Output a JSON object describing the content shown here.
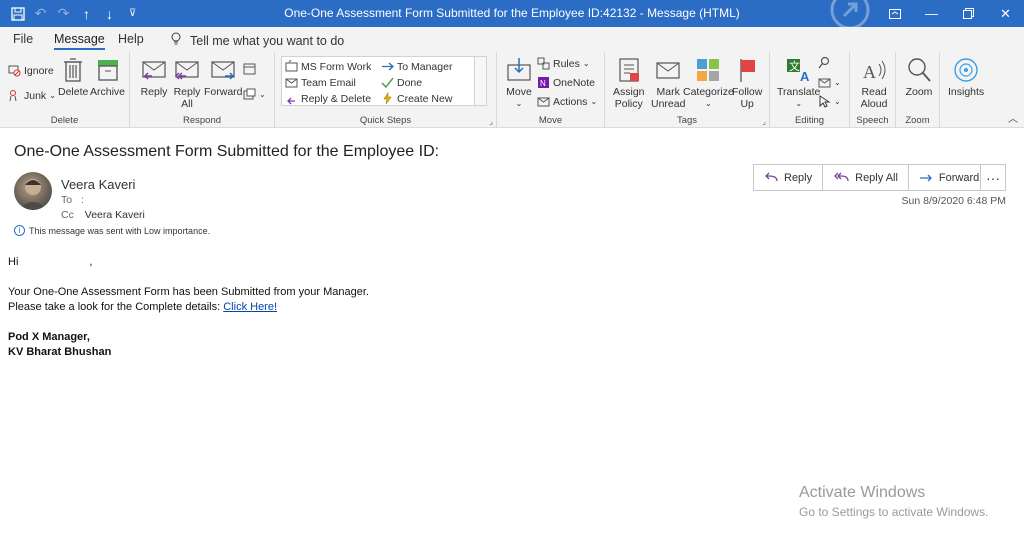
{
  "window": {
    "title": "One-One Assessment Form Submitted for the Employee ID:42132  -  Message (HTML)",
    "qat_icons": [
      "save-icon",
      "undo-icon",
      "redo-icon",
      "arrow-up-icon",
      "arrow-down-icon",
      "customize-icon"
    ],
    "controls": [
      "ribbon-display-icon",
      "minimize-icon",
      "restore-icon",
      "close-icon"
    ]
  },
  "menu": {
    "file": "File",
    "message": "Message",
    "help": "Help",
    "tell": "Tell me what you want to do"
  },
  "ribbon": {
    "delete_group": {
      "label": "Delete",
      "ignore": "Ignore",
      "junk": "Junk",
      "delete": "Delete",
      "archive": "Archive"
    },
    "respond_group": {
      "label": "Respond",
      "reply": "Reply",
      "reply_all_1": "Reply",
      "reply_all_2": "All",
      "forward": "Forward"
    },
    "quick_steps": {
      "label": "Quick Steps",
      "items": [
        "MS Form Work",
        "Team Email",
        "Reply & Delete",
        "To Manager",
        "Done",
        "Create New"
      ]
    },
    "move_group": {
      "label": "Move",
      "move": "Move",
      "rules": "Rules",
      "onenote": "OneNote",
      "actions": "Actions"
    },
    "tags_group": {
      "label": "Tags",
      "assign_1": "Assign",
      "assign_2": "Policy",
      "mark_1": "Mark",
      "mark_2": "Unread",
      "categorize": "Categorize",
      "follow_1": "Follow",
      "follow_2": "Up"
    },
    "editing_group": {
      "label": "Editing",
      "translate": "Translate"
    },
    "speech_group": {
      "label": "Speech",
      "read_1": "Read",
      "read_2": "Aloud"
    },
    "zoom_group": {
      "label": "Zoom",
      "zoom": "Zoom"
    },
    "insights": "Insights"
  },
  "message": {
    "subject": "One-One Assessment Form Submitted for the Employee ID:",
    "sender": "Veera Kaveri",
    "to_label": "To",
    "to_value": ":",
    "cc_label": "Cc",
    "cc_value": "Veera Kaveri",
    "date": "Sun 8/9/2020 6:48 PM",
    "importance": "This message was sent with Low importance.",
    "actions": {
      "reply": "Reply",
      "reply_all": "Reply All",
      "forward": "Forward",
      "more": "···"
    },
    "body": {
      "greeting": "Hi",
      "greeting_comma": ",",
      "line1": "Your One-One Assessment Form has been Submitted from your Manager.",
      "line2": "Please take a look for the Complete details: ",
      "link": "Click Here!",
      "sig1": "Pod X Manager,",
      "sig2": "KV Bharat Bhushan"
    }
  },
  "watermark": {
    "line1": "Activate Windows",
    "line2": "Go to Settings to activate Windows."
  },
  "colors": {
    "accent": "#2b6cc4",
    "link": "#0645ad"
  }
}
